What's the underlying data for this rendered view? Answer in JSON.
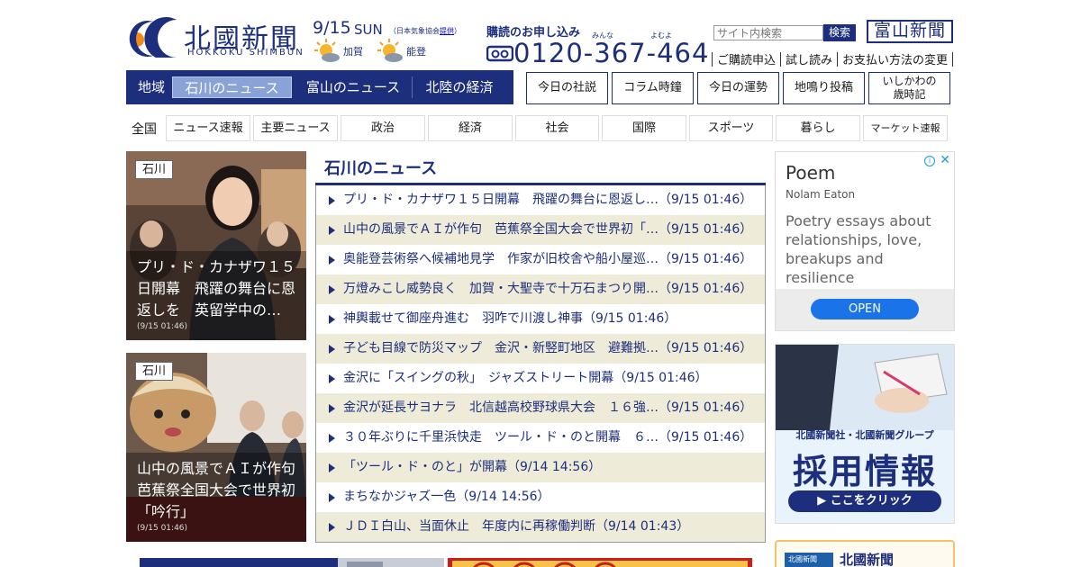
{
  "header": {
    "logo_text": "北國新聞",
    "logo_sub": "HOKKOKU SHIMBUN",
    "date": "9/15",
    "weekday": "SUN",
    "jma_prefix": "（日本気象協会",
    "jma_link": "提供",
    "jma_suffix": "）",
    "weather": [
      {
        "area": "加賀",
        "icon": "sun-cloud-icon"
      },
      {
        "area": "能登",
        "icon": "sun-cloud-icon"
      }
    ],
    "subscribe_title": "購読のお申し込み",
    "phone_number": "0120-367-464",
    "phone_ruby_1": "みんな",
    "phone_ruby_2": "よむよ",
    "search_placeholder": "サイト内検索",
    "search_button": "検索",
    "toyama_logo": "富山新聞",
    "sublinks": [
      "ご購読申込",
      "試し読み",
      "お支払い方法の変更"
    ]
  },
  "region_nav": {
    "label": "地域",
    "items": [
      "石川のニュース",
      "富山のニュース",
      "北陸の経済"
    ],
    "active_index": 0
  },
  "feature_buttons": [
    {
      "label": "今日の社説"
    },
    {
      "label": "コラム時鐘"
    },
    {
      "label": "今日の運勢"
    },
    {
      "label": "地鳴り投稿"
    },
    {
      "label_1": "いしかわの",
      "label_2": "歳時記"
    }
  ],
  "category_nav": {
    "label": "全国",
    "items": [
      "ニュース速報",
      "主要ニュース",
      "政治",
      "経済",
      "社会",
      "国際",
      "スポーツ",
      "暮らし",
      "マーケット速報"
    ]
  },
  "photo_stories": [
    {
      "tag": "石川",
      "headline": "プリ・ド・カナザワ１５日開幕　飛躍の舞台に恩返しを　英留学中の…",
      "time": "(9/15 01:46)"
    },
    {
      "tag": "石川",
      "headline": "山中の風景でＡＩが作句　芭蕉祭全国大会で世界初「吟行」",
      "time": "(9/15 01:46)"
    }
  ],
  "news": {
    "title": "石川のニュース",
    "items": [
      "プリ・ド・カナザワ１５日開幕　飛躍の舞台に恩返し…（9/15 01:46）",
      "山中の風景でＡＩが作句　芭蕉祭全国大会で世界初「…（9/15 01:46）",
      "奥能登芸術祭へ候補地見学　作家が旧校舎や船小屋巡…（9/15 01:46）",
      "万燈みこし威勢良く　加賀・大聖寺で十万石まつり開…（9/15 01:46）",
      "神輿載せて御座舟進む　羽咋で川渡し神事（9/15 01:46）",
      "子ども目線で防災マップ　金沢・新竪町地区　避難拠…（9/15 01:46）",
      "金沢に「スイングの秋」　ジャズストリート開幕（9/15 01:46）",
      "金沢が延長サヨナラ　北信越高校野球県大会　１６強…（9/15 01:46）",
      "３０年ぶりに千里浜快走　ツール・ド・のと開幕　６…（9/15 01:46）",
      "「ツール・ド・のと」が開幕（9/14 14:56）",
      "まちなかジャズ一色（9/14 14:56）",
      "ＪＤＩ白山、当面休止　年度内に再稼働判断（9/14 01:43）"
    ]
  },
  "ads": {
    "ad1_title": "Poem",
    "ad1_author": "Nolam Eaton",
    "ad1_desc": "Poetry essays about relationships, love, breakups and resilience",
    "ad1_button": "OPEN",
    "ad1_info": "i",
    "ad1_close": "✕",
    "ad2_company": "北國新聞社・北國新聞グループ",
    "ad2_big": "採用情報",
    "ad2_cta": "▶ ここをクリック",
    "ad3_block": "北國新聞",
    "ad3_name": "北國新聞"
  },
  "colors": {
    "brand_navy": "#1d2f7c",
    "active_tab": "#8aa3d6",
    "stripe": "#eeebd8",
    "ad_button": "#1a73e8"
  }
}
